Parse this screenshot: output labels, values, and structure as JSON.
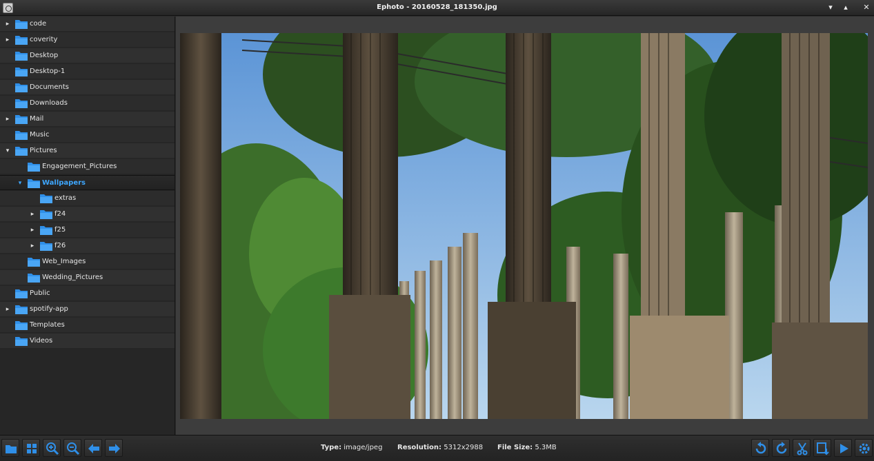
{
  "window": {
    "title": "Ephoto - 20160528_181350.jpg"
  },
  "tree": [
    {
      "label": "code",
      "depth": 0,
      "expander": "collapsed"
    },
    {
      "label": "coverity",
      "depth": 0,
      "expander": "collapsed"
    },
    {
      "label": "Desktop",
      "depth": 0,
      "expander": "none"
    },
    {
      "label": "Desktop-1",
      "depth": 0,
      "expander": "none"
    },
    {
      "label": "Documents",
      "depth": 0,
      "expander": "none"
    },
    {
      "label": "Downloads",
      "depth": 0,
      "expander": "none"
    },
    {
      "label": "Mail",
      "depth": 0,
      "expander": "collapsed"
    },
    {
      "label": "Music",
      "depth": 0,
      "expander": "none"
    },
    {
      "label": "Pictures",
      "depth": 0,
      "expander": "expanded"
    },
    {
      "label": "Engagement_Pictures",
      "depth": 1,
      "expander": "none"
    },
    {
      "label": "Wallpapers",
      "depth": 1,
      "expander": "expanded",
      "selected": true
    },
    {
      "label": "extras",
      "depth": 2,
      "expander": "none"
    },
    {
      "label": "f24",
      "depth": 2,
      "expander": "collapsed"
    },
    {
      "label": "f25",
      "depth": 2,
      "expander": "collapsed"
    },
    {
      "label": "f26",
      "depth": 2,
      "expander": "collapsed"
    },
    {
      "label": "Web_Images",
      "depth": 1,
      "expander": "none"
    },
    {
      "label": "Wedding_Pictures",
      "depth": 1,
      "expander": "none"
    },
    {
      "label": "Public",
      "depth": 0,
      "expander": "none"
    },
    {
      "label": "spotify-app",
      "depth": 0,
      "expander": "collapsed"
    },
    {
      "label": "Templates",
      "depth": 0,
      "expander": "none"
    },
    {
      "label": "Videos",
      "depth": 0,
      "expander": "none"
    }
  ],
  "status": {
    "type_label": "Type:",
    "type_value": "image/jpeg",
    "resolution_label": "Resolution:",
    "resolution_value": "5312x2988",
    "filesize_label": "File Size:",
    "filesize_value": "5.3MB"
  },
  "toolbar_left": [
    "folder-icon",
    "thumbnail-grid-icon",
    "zoom-in-icon",
    "zoom-out-icon",
    "arrow-left-icon",
    "arrow-right-icon"
  ],
  "toolbar_right": [
    "rotate-left-icon",
    "rotate-right-icon",
    "cut-icon",
    "save-icon",
    "play-icon",
    "settings-icon"
  ],
  "colors": {
    "accent": "#3ea7ff",
    "folder": "#2f8fe8",
    "background": "#2b2b2b"
  }
}
